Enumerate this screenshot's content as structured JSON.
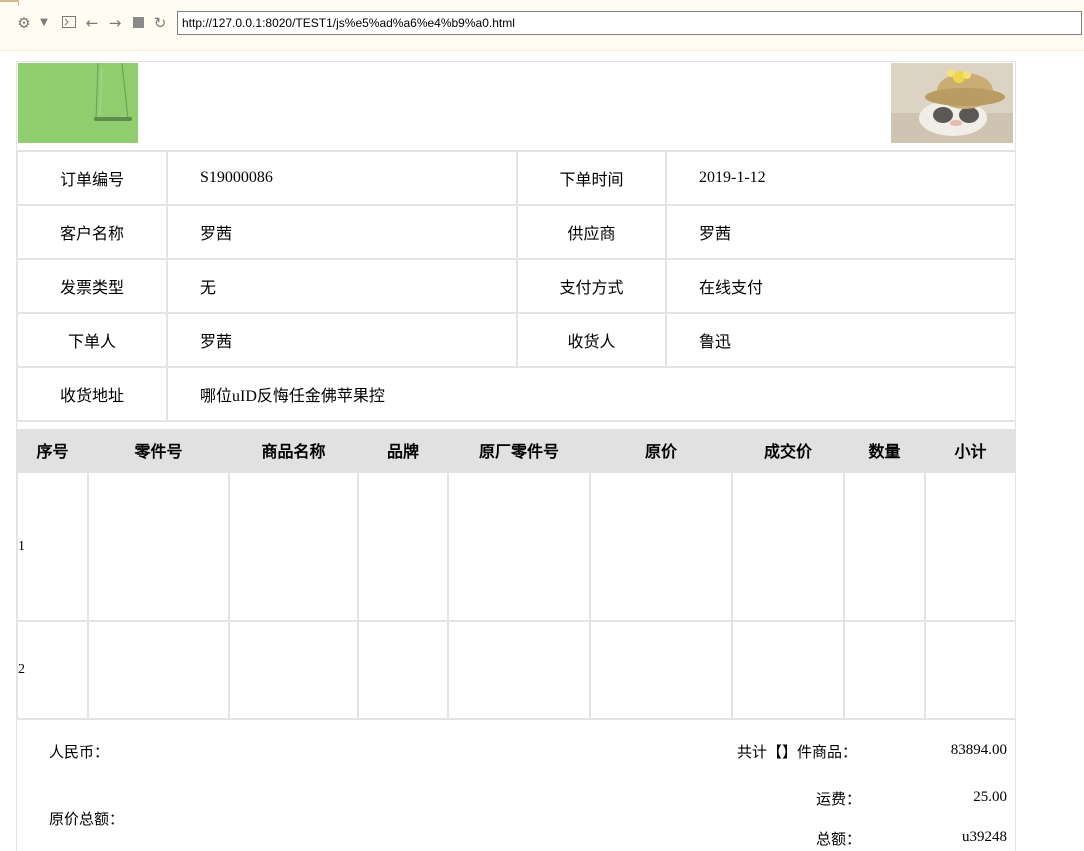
{
  "browser": {
    "url": "http://127.0.0.1:8020/TEST1/js%e5%ad%a6%e4%b9%a0.html",
    "icons": [
      "gear-icon",
      "dropdown-icon",
      "console-icon",
      "back-icon",
      "forward-icon",
      "stop-icon",
      "reload-icon"
    ]
  },
  "order": {
    "rows": [
      {
        "l1": "订单编号",
        "v1": "S19000086",
        "l2": "下单时间",
        "v2": "2019-1-12"
      },
      {
        "l1": "客户名称",
        "v1": "罗茜",
        "l2": "供应商",
        "v2": "罗茜"
      },
      {
        "l1": "发票类型",
        "v1": "无",
        "l2": "支付方式",
        "v2": "在线支付"
      },
      {
        "l1": "下单人",
        "v1": "罗茜",
        "l2": "收货人",
        "v2": "鲁迅"
      }
    ],
    "address_label": "收货地址",
    "address_value": "哪位uID反悔任金佛苹果控"
  },
  "items": {
    "headers": [
      "序号",
      "零件号",
      "商品名称",
      "品牌",
      "原厂零件号",
      "原价",
      "成交价",
      "数量",
      "小计"
    ],
    "rows": [
      {
        "index": "1"
      },
      {
        "index": "2"
      }
    ]
  },
  "summary": {
    "rmb_label": "人民币：",
    "original_total_label": "原价总额：",
    "count_label": "共计【】件商品：",
    "count_value": "83894.00",
    "shipping_label": "运费：",
    "shipping_value": "25.00",
    "total_label": "总额：",
    "total_value": "u39248"
  },
  "colors": {
    "logo": "#8fcd6f",
    "header_bg": "#e1e1e1",
    "border": "#e3e3e3"
  }
}
